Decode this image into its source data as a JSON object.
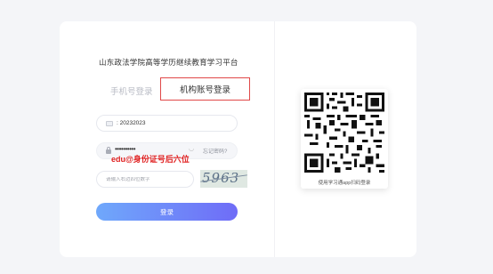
{
  "platform": {
    "title": "山东政法学院高等学历继续教育学习平台"
  },
  "tabs": {
    "phone_login": "手机号登录",
    "org_login": "机构账号登录"
  },
  "form": {
    "account_value": ": 20232023",
    "password_mask": "••••••••••",
    "forgot_password": "忘记密码?",
    "annotation": "edu@身份证号后六位",
    "captcha_placeholder": "请输入右边四位数字",
    "captcha_text": "5963",
    "login_button": "登录"
  },
  "qr": {
    "caption": "使用学习通app扫码登录"
  },
  "colors": {
    "accent_start": "#6fa8fb",
    "accent_end": "#6f6cf7",
    "highlight_box": "#e04848",
    "annotation": "#e02020"
  }
}
